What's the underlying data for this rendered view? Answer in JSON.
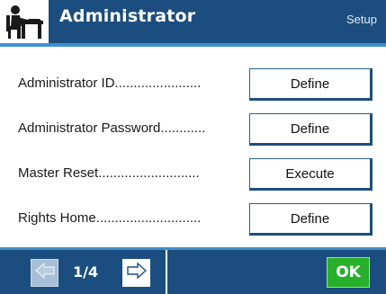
{
  "header": {
    "title": "Administrator",
    "context": "Setup",
    "icon": "administrator-icon"
  },
  "rows": [
    {
      "label": "Administrator ID.......................",
      "button": "Define"
    },
    {
      "label": "Administrator Password............",
      "button": "Define"
    },
    {
      "label": "Master Reset...........................",
      "button": "Execute"
    },
    {
      "label": "Rights Home............................",
      "button": "Define"
    }
  ],
  "footer": {
    "page": "1/4",
    "prev_icon": "arrow-left-icon",
    "next_icon": "arrow-right-icon",
    "ok_label": "OK"
  },
  "colors": {
    "header_bg": "#1b4e7e",
    "accent": "#3f8fd0",
    "ok_green": "#27b02a"
  }
}
